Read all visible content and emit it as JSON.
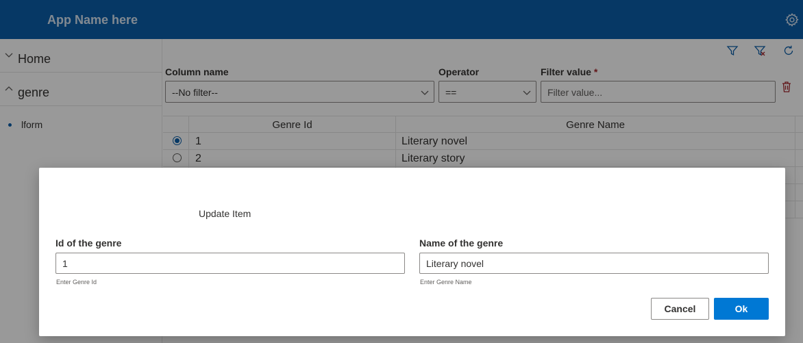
{
  "app": {
    "title": "App Name here"
  },
  "icons": {
    "settings": "gear-icon",
    "filter": "filter-icon",
    "clear_filter": "clear-filter-icon",
    "refresh": "refresh-icon",
    "delete": "trash-icon"
  },
  "colors": {
    "brand": "#0a5ea8",
    "primary_button": "#0078d4",
    "required": "#a4262c"
  },
  "sidebar": {
    "items": [
      {
        "label": "Home",
        "expanded": false
      },
      {
        "label": "genre",
        "expanded": true
      }
    ],
    "sub_items": [
      {
        "label": "lform"
      }
    ]
  },
  "filter": {
    "column_label": "Column name",
    "column_value": "--No filter--",
    "operator_label": "Operator",
    "operator_value": "==",
    "value_label": "Filter value",
    "value_required": "*",
    "value_placeholder": "Filter value..."
  },
  "grid": {
    "columns": [
      "Genre Id",
      "Genre Name"
    ],
    "rows": [
      {
        "id": "1",
        "name": "Literary novel",
        "selected": true
      },
      {
        "id": "2",
        "name": "Literary story",
        "selected": false
      }
    ]
  },
  "dialog": {
    "title": "Update Item",
    "id_label": "Id of the genre",
    "id_value": "1",
    "id_help": "Enter Genre Id",
    "name_label": "Name of the genre",
    "name_value": "Literary novel",
    "name_help": "Enter Genre Name",
    "cancel_label": "Cancel",
    "ok_label": "Ok"
  }
}
